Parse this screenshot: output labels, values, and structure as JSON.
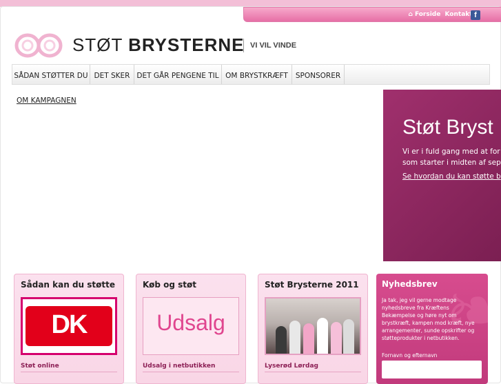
{
  "top_links": {
    "home": "Forside",
    "contact": "Kontakt",
    "separator": "|",
    "facebook_icon": "f"
  },
  "logo": {
    "name_light": "STØT",
    "name_bold": "BRYSTERNE",
    "tagline": "VI VIL VINDE"
  },
  "nav": {
    "items": [
      "SÅDAN STØTTER DU",
      "DET SKER",
      "DET GÅR PENGENE TIL",
      "OM BRYSTKRÆFT",
      "SPONSORER"
    ]
  },
  "subnav": {
    "item": "OM KAMPAGNEN"
  },
  "hero": {
    "title": "Støt Bryst",
    "text_line1": "Vi er i fuld gang med at for",
    "text_line2": "som starter i midten af sep",
    "link": "Se hvordan du kan støtte b"
  },
  "cards": [
    {
      "title": "Sådan kan du støtte",
      "image_text": "DK",
      "link": "Støt online"
    },
    {
      "title": "Køb og støt",
      "image_text": "Udsalg",
      "link": "Udsalg i netbutikken"
    },
    {
      "title": "Støt Brysterne 2011",
      "link": "Lyserød Lørdag"
    }
  ],
  "newsletter": {
    "title": "Nyhedsbrev",
    "text": "Ja tak, jeg vil gerne modtage nyhedsbreve fra Kræftens Bekæmpelse og høre nyt om brystkræft, kampen mod kræft, nye arrangementer, sunde opskrifter og støtteprodukter i netbutikken.",
    "name_label": "Fornavn og efternavn"
  },
  "colors": {
    "accent": "#d5006d",
    "hero_bg": "#8c2660",
    "card_bg": "#fbe1ee",
    "newsletter_bg": "#cc4486"
  }
}
